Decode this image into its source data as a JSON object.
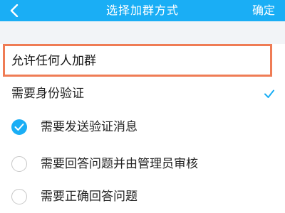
{
  "header": {
    "title": "选择加群方式",
    "confirm_label": "确定",
    "background_color": "#1aaef5"
  },
  "options": {
    "allow_anyone": "允许任何人加群",
    "require_identity": "需要身份验证",
    "require_identity_checked": true,
    "highlight_color": "#ef7c55",
    "sub_options": [
      {
        "label": "需要发送验证消息",
        "selected": true
      },
      {
        "label": "需要回答问题并由管理员审核",
        "selected": false
      },
      {
        "label": "需要正确回答问题",
        "selected": false
      }
    ]
  },
  "icons": {
    "back": "back-chevron-icon",
    "check": "checkmark-icon",
    "radio_on": "radio-checked-icon",
    "radio_off": "radio-unchecked-icon"
  }
}
